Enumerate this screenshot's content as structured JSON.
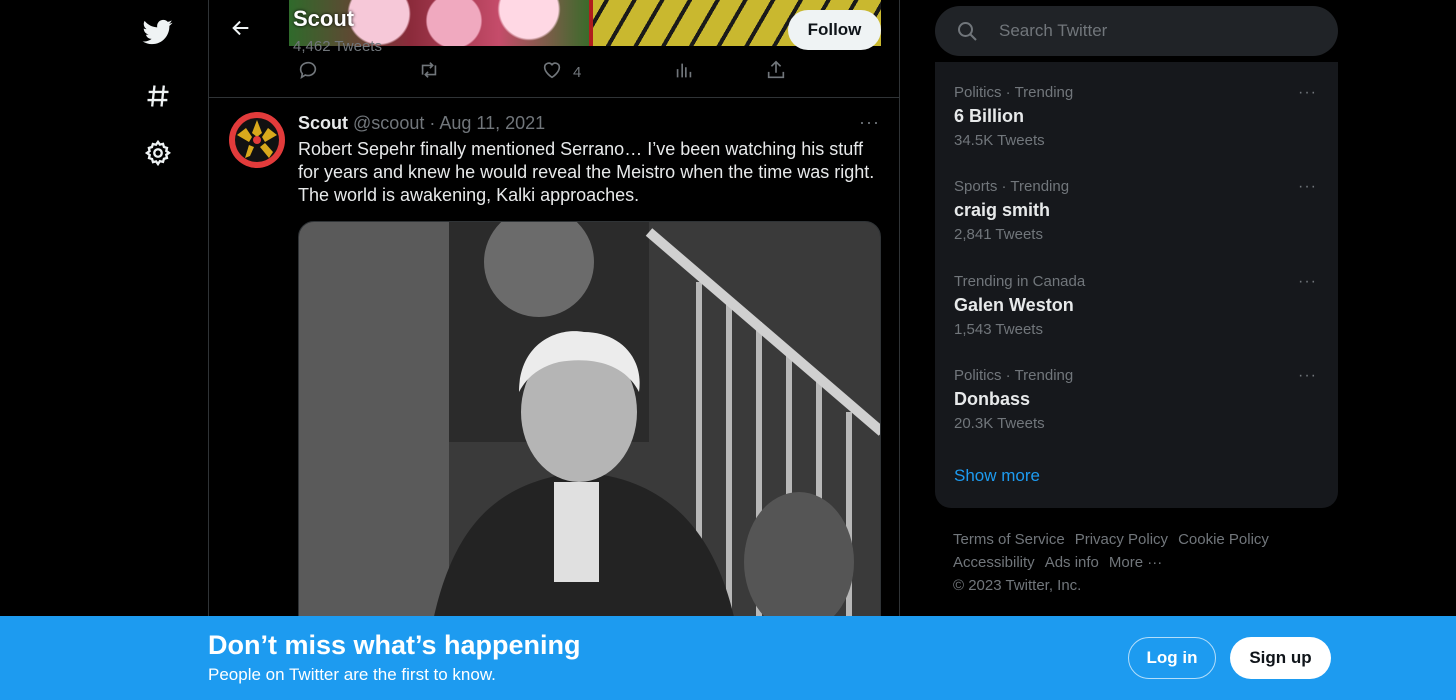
{
  "nav": {
    "icons": [
      "twitter-logo-icon",
      "hashtag-icon",
      "settings-gear-icon"
    ]
  },
  "profile": {
    "name": "Scout",
    "tweet_count": "4,462 Tweets",
    "follow_label": "Follow"
  },
  "prev_tweet_actions": {
    "reply": "",
    "retweet": "",
    "like_count": "4",
    "views": "",
    "share": ""
  },
  "tweet": {
    "name": "Scout",
    "handle": "@scoout",
    "date": "Aug 11, 2021",
    "text": "Robert Sepehr finally mentioned Serrano… I’ve been watching his stuff for years and knew he would reveal the Meistro when the time was right. The world is awakening, Kalki approaches.",
    "more": "···"
  },
  "search": {
    "placeholder": "Search Twitter"
  },
  "trends": [
    {
      "context": "Politics · Trending",
      "name": "6 Billion",
      "count": "34.5K Tweets"
    },
    {
      "context": "Sports · Trending",
      "name": "craig smith",
      "count": "2,841 Tweets"
    },
    {
      "context": "Trending in Canada",
      "name": "Galen Weston",
      "count": "1,543 Tweets"
    },
    {
      "context": "Politics · Trending",
      "name": "Donbass",
      "count": "20.3K Tweets"
    }
  ],
  "trend_more": "···",
  "show_more": "Show more",
  "footer": {
    "terms": "Terms of Service",
    "privacy": "Privacy Policy",
    "cookie": "Cookie Policy",
    "accessibility": "Accessibility",
    "ads": "Ads info",
    "more": "More ···",
    "copyright": "© 2023 Twitter, Inc."
  },
  "bottom_bar": {
    "title": "Don’t miss what’s happening",
    "subtitle": "People on Twitter are the first to know.",
    "login_label": "Log in",
    "signup_label": "Sign up"
  },
  "colors": {
    "accent": "#1d9bf0",
    "background": "#000000",
    "panel": "#16181c",
    "muted_text": "#71767b"
  }
}
